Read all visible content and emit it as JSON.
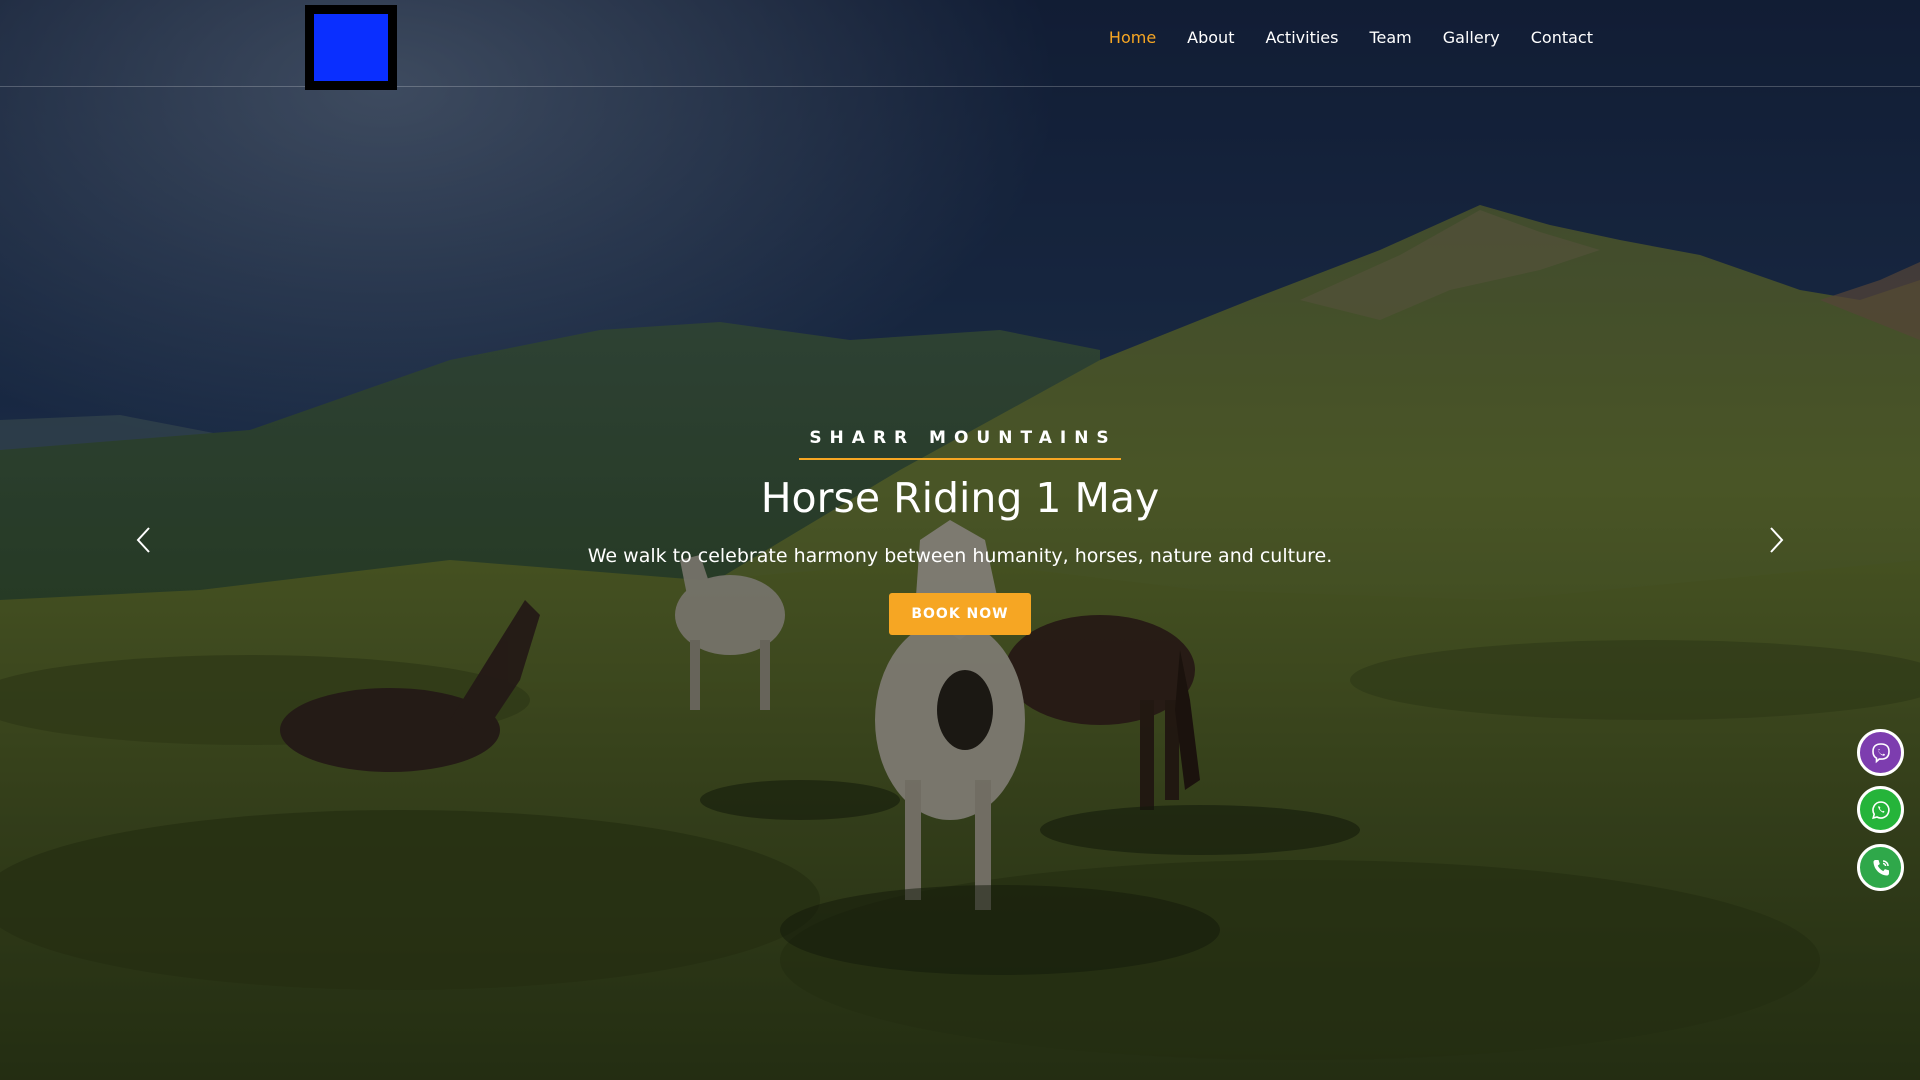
{
  "colors": {
    "accent": "#f6a623",
    "viber": "#7d3daf",
    "whatsapp": "#25b43a",
    "phone": "#2fa84a",
    "logo_blue": "#0a2fff"
  },
  "header": {
    "nav": [
      {
        "label": "Home",
        "active": true
      },
      {
        "label": "About",
        "active": false
      },
      {
        "label": "Activities",
        "active": false
      },
      {
        "label": "Team",
        "active": false
      },
      {
        "label": "Gallery",
        "active": false
      },
      {
        "label": "Contact",
        "active": false
      }
    ]
  },
  "hero": {
    "eyebrow": "SHARR MOUNTAINS",
    "title": "Horse Riding 1 May",
    "subtitle": "We walk to celebrate harmony between humanity, horses, nature and culture.",
    "button_label": "BOOK NOW"
  },
  "icons": {
    "prev": "chevron-left-icon",
    "next": "chevron-right-icon",
    "contacts": [
      "viber-icon",
      "whatsapp-icon",
      "phone-icon"
    ]
  }
}
